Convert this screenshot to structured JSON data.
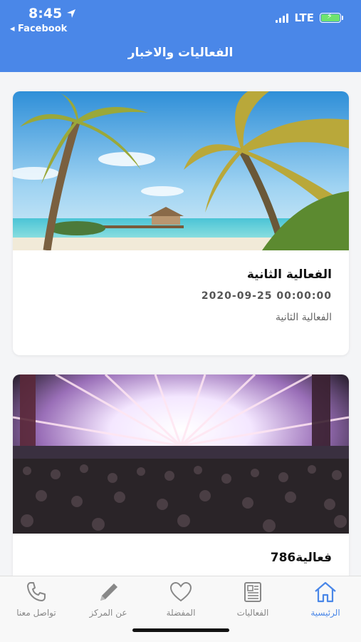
{
  "status_bar": {
    "time": "8:45",
    "back_app": "◂ Facebook",
    "network": "LTE"
  },
  "header": {
    "title": "الفعاليات والاخبار"
  },
  "events": [
    {
      "title": "الفعالية الثانية",
      "date": "2020-09-25 00:00:00",
      "description": "الفعالية الثانية",
      "image": "beach-palm-photo"
    },
    {
      "title": "فعالية786",
      "image": "concert-crowd-photo"
    }
  ],
  "tabs": [
    {
      "label": "الرئيسية",
      "icon": "home-icon",
      "active": true
    },
    {
      "label": "الفعاليات",
      "icon": "newspaper-icon",
      "active": false
    },
    {
      "label": "المفضلة",
      "icon": "heart-icon",
      "active": false
    },
    {
      "label": "عن المركز",
      "icon": "pencil-icon",
      "active": false
    },
    {
      "label": "تواصل معنا",
      "icon": "phone-icon",
      "active": false
    }
  ],
  "colors": {
    "accent": "#4a87e8",
    "tab_inactive": "#888888",
    "battery": "#6ee36f"
  }
}
